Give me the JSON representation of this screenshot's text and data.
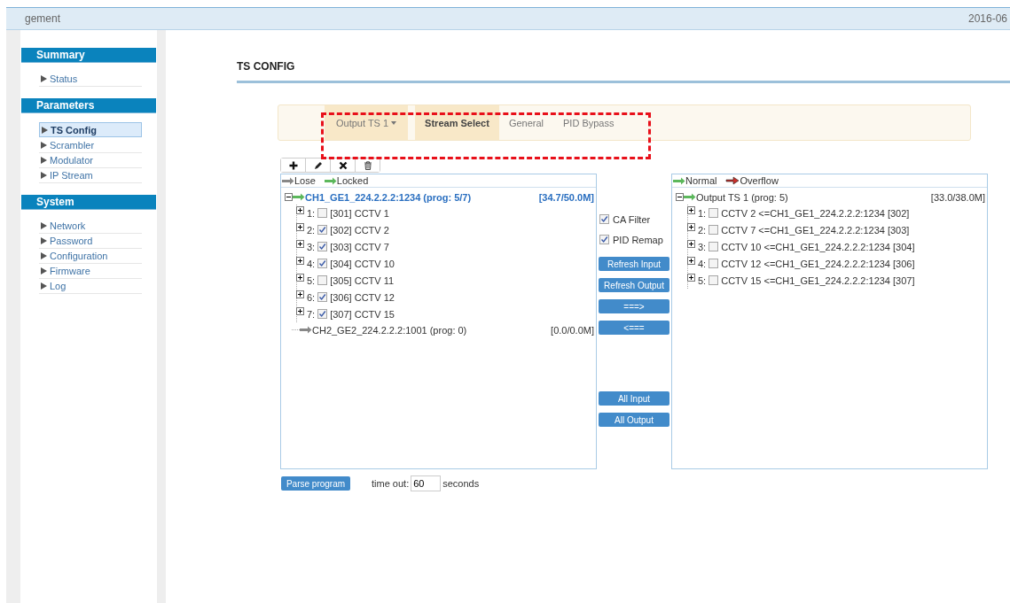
{
  "header": {
    "title": "gement",
    "date": "2016-06"
  },
  "sidebar": {
    "sections": [
      {
        "title": "Summary",
        "items": [
          {
            "label": "Status",
            "selected": false
          }
        ]
      },
      {
        "title": "Parameters",
        "items": [
          {
            "label": "TS Config",
            "selected": true
          },
          {
            "label": "Scrambler",
            "selected": false
          },
          {
            "label": "Modulator",
            "selected": false
          },
          {
            "label": "IP Stream",
            "selected": false
          }
        ]
      },
      {
        "title": "System",
        "items": [
          {
            "label": "Network",
            "selected": false
          },
          {
            "label": "Password",
            "selected": false
          },
          {
            "label": "Configuration",
            "selected": false
          },
          {
            "label": "Firmware",
            "selected": false
          },
          {
            "label": "Log",
            "selected": false
          }
        ]
      }
    ]
  },
  "page_title": "TS CONFIG",
  "tabs": [
    {
      "label": "Output TS 1",
      "kind": "dropdown",
      "selected": false
    },
    {
      "label": "Stream Select",
      "kind": "tab",
      "selected": true
    },
    {
      "label": "General",
      "kind": "tab",
      "selected": false
    },
    {
      "label": "PID Bypass",
      "kind": "tab",
      "selected": false
    }
  ],
  "toolbar": [
    {
      "kind": "add"
    },
    {
      "kind": "edit"
    },
    {
      "kind": "remove"
    },
    {
      "kind": "delete"
    }
  ],
  "input_panel": {
    "legend": [
      {
        "label": "Lose",
        "kind": "lose"
      },
      {
        "label": "Locked",
        "kind": "locked"
      }
    ],
    "roots": [
      {
        "label": "CH1_GE1_224.2.2.2:1234 (prog: 5/7)",
        "rate": "[34.7/50.0M]",
        "kind": "locked",
        "selected": true,
        "expanded": true,
        "children": [
          {
            "index": "1:",
            "label": "[301] CCTV 1",
            "checked": false
          },
          {
            "index": "2:",
            "label": "[302] CCTV 2",
            "checked": true
          },
          {
            "index": "3:",
            "label": "[303] CCTV 7",
            "checked": true
          },
          {
            "index": "4:",
            "label": "[304] CCTV 10",
            "checked": true
          },
          {
            "index": "5:",
            "label": "[305] CCTV 11",
            "checked": false
          },
          {
            "index": "6:",
            "label": "[306] CCTV 12",
            "checked": true
          },
          {
            "index": "7:",
            "label": "[307] CCTV 15",
            "checked": true
          }
        ]
      },
      {
        "label": "CH2_GE2_224.2.2.2:1001 (prog: 0)",
        "rate": "[0.0/0.0M]",
        "kind": "lose",
        "selected": false
      }
    ]
  },
  "options": [
    {
      "label": "CA Filter",
      "checked": true
    },
    {
      "label": "PID Remap",
      "checked": true
    }
  ],
  "action_buttons": [
    {
      "label": "Refresh Input",
      "kind": "top"
    },
    {
      "label": "Refresh Output",
      "kind": "top"
    },
    {
      "label": "===>",
      "kind": "top"
    },
    {
      "label": "<===",
      "kind": "top"
    },
    {
      "label": "All Input",
      "kind": "bottom"
    },
    {
      "label": "All Output",
      "kind": "bottom"
    }
  ],
  "output_panel": {
    "legend": [
      {
        "label": "Normal",
        "kind": "normal"
      },
      {
        "label": "Overflow",
        "kind": "overflow"
      }
    ],
    "roots": [
      {
        "label": "Output TS 1 (prog: 5)",
        "rate": "[33.0/38.0M]",
        "kind": "normal",
        "selected": false,
        "expanded": true,
        "children": [
          {
            "index": "1:",
            "label": "CCTV 2 <=CH1_GE1_224.2.2.2:1234 [302]",
            "checked": false
          },
          {
            "index": "2:",
            "label": "CCTV 7 <=CH1_GE1_224.2.2.2:1234 [303]",
            "checked": false
          },
          {
            "index": "3:",
            "label": "CCTV 10 <=CH1_GE1_224.2.2.2:1234 [304]",
            "checked": false
          },
          {
            "index": "4:",
            "label": "CCTV 12 <=CH1_GE1_224.2.2.2:1234 [306]",
            "checked": false
          },
          {
            "index": "5:",
            "label": "CCTV 15 <=CH1_GE1_224.2.2.2:1234 [307]",
            "checked": false
          }
        ]
      }
    ]
  },
  "parse": {
    "button": "Parse program",
    "timeout_label": "time out:",
    "timeout_value": "60",
    "unit": "seconds"
  }
}
